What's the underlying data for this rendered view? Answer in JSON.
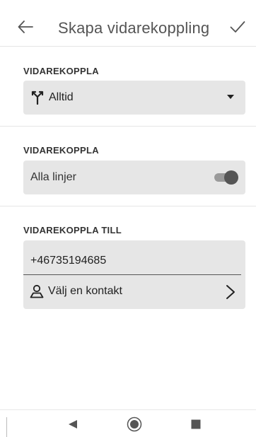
{
  "header": {
    "title": "Skapa vidarekoppling",
    "back_icon": "arrow-left-icon",
    "confirm_icon": "checkmark-icon"
  },
  "sections": [
    {
      "label": "VIDAREKOPPLA",
      "dropdown": {
        "icon": "call-forward-icon",
        "value": "Alltid"
      }
    },
    {
      "label": "VIDAREKOPPLA",
      "toggle": {
        "label": "Alla linjer",
        "on": true
      }
    },
    {
      "label": "VIDAREKOPPLA TILL",
      "phone_value": "+46735194685",
      "contact_row": {
        "icon": "person-icon",
        "label": "Välj en kontakt",
        "chevron": "chevron-right-icon"
      }
    }
  ],
  "nav_bar": {
    "back": "nav-back-icon",
    "home": "nav-home-icon",
    "recents": "nav-recents-icon"
  },
  "colors": {
    "card_bg": "#e6e6e6",
    "toggle_track": "#9a9a9a",
    "toggle_thumb": "#555555",
    "divider": "#e5e5e5"
  }
}
